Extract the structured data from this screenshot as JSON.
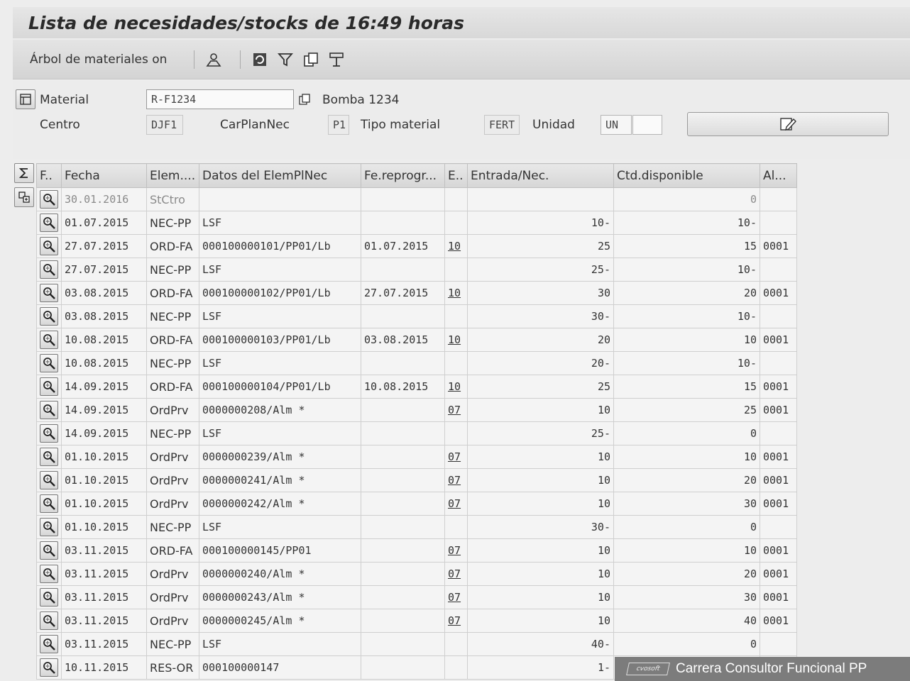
{
  "window": {
    "title": "Lista de necesidades/stocks de 16:49 horas"
  },
  "toolbar": {
    "tree_label": "Árbol de materiales on",
    "icons": [
      "person-icon",
      "refresh-icon",
      "filter-icon",
      "copy-icon",
      "layout-icon"
    ]
  },
  "header": {
    "material_label": "Material",
    "material_value": "R-F1234",
    "material_desc": "Bomba 1234",
    "centro_label": "Centro",
    "centro_value": "DJF1",
    "carplan_label": "CarPlanNec",
    "carplan_value": "P1",
    "tipo_label": "Tipo material",
    "tipo_value": "FERT",
    "unidad_label": "Unidad",
    "unidad_value": "UN"
  },
  "table": {
    "headers": [
      "F..",
      "Fecha",
      "Elem....",
      "Datos del ElemPlNec",
      "Fe.reprogr...",
      "E..",
      "Entrada/Nec.",
      "Ctd.disponible",
      "Al..."
    ],
    "rows": [
      [
        "30.01.2016",
        "StCtro",
        "",
        "",
        "",
        "",
        "0",
        ""
      ],
      [
        "01.07.2015",
        "NEC-PP",
        "LSF",
        "",
        "",
        "10-",
        "10-",
        ""
      ],
      [
        "27.07.2015",
        "ORD-FA",
        "000100000101/PP01/Lb",
        "01.07.2015",
        "10",
        "25",
        "15",
        "0001"
      ],
      [
        "27.07.2015",
        "NEC-PP",
        "LSF",
        "",
        "",
        "25-",
        "10-",
        ""
      ],
      [
        "03.08.2015",
        "ORD-FA",
        "000100000102/PP01/Lb",
        "27.07.2015",
        "10",
        "30",
        "20",
        "0001"
      ],
      [
        "03.08.2015",
        "NEC-PP",
        "LSF",
        "",
        "",
        "30-",
        "10-",
        ""
      ],
      [
        "10.08.2015",
        "ORD-FA",
        "000100000103/PP01/Lb",
        "03.08.2015",
        "10",
        "20",
        "10",
        "0001"
      ],
      [
        "10.08.2015",
        "NEC-PP",
        "LSF",
        "",
        "",
        "20-",
        "10-",
        ""
      ],
      [
        "14.09.2015",
        "ORD-FA",
        "000100000104/PP01/Lb",
        "10.08.2015",
        "10",
        "25",
        "15",
        "0001"
      ],
      [
        "14.09.2015",
        "OrdPrv",
        "0000000208/Alm *",
        "",
        "07",
        "10",
        "25",
        "0001"
      ],
      [
        "14.09.2015",
        "NEC-PP",
        "LSF",
        "",
        "",
        "25-",
        "0",
        ""
      ],
      [
        "01.10.2015",
        "OrdPrv",
        "0000000239/Alm *",
        "",
        "07",
        "10",
        "10",
        "0001"
      ],
      [
        "01.10.2015",
        "OrdPrv",
        "0000000241/Alm *",
        "",
        "07",
        "10",
        "20",
        "0001"
      ],
      [
        "01.10.2015",
        "OrdPrv",
        "0000000242/Alm *",
        "",
        "07",
        "10",
        "30",
        "0001"
      ],
      [
        "01.10.2015",
        "NEC-PP",
        "LSF",
        "",
        "",
        "30-",
        "0",
        ""
      ],
      [
        "03.11.2015",
        "ORD-FA",
        "000100000145/PP01",
        "",
        "07",
        "10",
        "10",
        "0001"
      ],
      [
        "03.11.2015",
        "OrdPrv",
        "0000000240/Alm *",
        "",
        "07",
        "10",
        "20",
        "0001"
      ],
      [
        "03.11.2015",
        "OrdPrv",
        "0000000243/Alm *",
        "",
        "07",
        "10",
        "30",
        "0001"
      ],
      [
        "03.11.2015",
        "OrdPrv",
        "0000000245/Alm *",
        "",
        "07",
        "10",
        "40",
        "0001"
      ],
      [
        "03.11.2015",
        "NEC-PP",
        "LSF",
        "",
        "",
        "40-",
        "0",
        ""
      ],
      [
        "10.11.2015",
        "RES-OR",
        "000100000147",
        "",
        "",
        "1-",
        "",
        ""
      ]
    ]
  },
  "watermark": {
    "logo": "cvosoft",
    "text": "Carrera Consultor Funcional PP"
  }
}
